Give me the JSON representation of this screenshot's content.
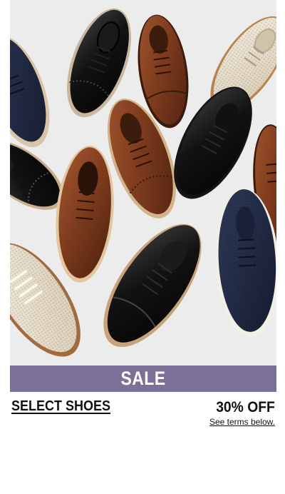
{
  "promo": {
    "banner_label": "SALE",
    "category_label": "SELECT SHOES",
    "discount_label": "30% OFF",
    "terms_label": "See terms below."
  },
  "colors": {
    "banner": "#7c6f98",
    "hero_background": "#ececec",
    "text": "#111111"
  }
}
